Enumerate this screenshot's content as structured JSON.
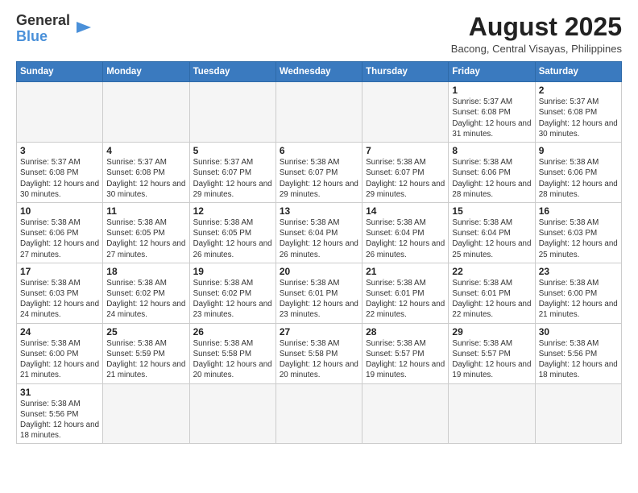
{
  "header": {
    "logo_general": "General",
    "logo_blue": "Blue",
    "month_year": "August 2025",
    "location": "Bacong, Central Visayas, Philippines"
  },
  "weekdays": [
    "Sunday",
    "Monday",
    "Tuesday",
    "Wednesday",
    "Thursday",
    "Friday",
    "Saturday"
  ],
  "weeks": [
    [
      {
        "day": "",
        "info": ""
      },
      {
        "day": "",
        "info": ""
      },
      {
        "day": "",
        "info": ""
      },
      {
        "day": "",
        "info": ""
      },
      {
        "day": "",
        "info": ""
      },
      {
        "day": "1",
        "info": "Sunrise: 5:37 AM\nSunset: 6:08 PM\nDaylight: 12 hours\nand 31 minutes."
      },
      {
        "day": "2",
        "info": "Sunrise: 5:37 AM\nSunset: 6:08 PM\nDaylight: 12 hours\nand 30 minutes."
      }
    ],
    [
      {
        "day": "3",
        "info": "Sunrise: 5:37 AM\nSunset: 6:08 PM\nDaylight: 12 hours\nand 30 minutes."
      },
      {
        "day": "4",
        "info": "Sunrise: 5:37 AM\nSunset: 6:08 PM\nDaylight: 12 hours\nand 30 minutes."
      },
      {
        "day": "5",
        "info": "Sunrise: 5:37 AM\nSunset: 6:07 PM\nDaylight: 12 hours\nand 29 minutes."
      },
      {
        "day": "6",
        "info": "Sunrise: 5:38 AM\nSunset: 6:07 PM\nDaylight: 12 hours\nand 29 minutes."
      },
      {
        "day": "7",
        "info": "Sunrise: 5:38 AM\nSunset: 6:07 PM\nDaylight: 12 hours\nand 29 minutes."
      },
      {
        "day": "8",
        "info": "Sunrise: 5:38 AM\nSunset: 6:06 PM\nDaylight: 12 hours\nand 28 minutes."
      },
      {
        "day": "9",
        "info": "Sunrise: 5:38 AM\nSunset: 6:06 PM\nDaylight: 12 hours\nand 28 minutes."
      }
    ],
    [
      {
        "day": "10",
        "info": "Sunrise: 5:38 AM\nSunset: 6:06 PM\nDaylight: 12 hours\nand 27 minutes."
      },
      {
        "day": "11",
        "info": "Sunrise: 5:38 AM\nSunset: 6:05 PM\nDaylight: 12 hours\nand 27 minutes."
      },
      {
        "day": "12",
        "info": "Sunrise: 5:38 AM\nSunset: 6:05 PM\nDaylight: 12 hours\nand 26 minutes."
      },
      {
        "day": "13",
        "info": "Sunrise: 5:38 AM\nSunset: 6:04 PM\nDaylight: 12 hours\nand 26 minutes."
      },
      {
        "day": "14",
        "info": "Sunrise: 5:38 AM\nSunset: 6:04 PM\nDaylight: 12 hours\nand 26 minutes."
      },
      {
        "day": "15",
        "info": "Sunrise: 5:38 AM\nSunset: 6:04 PM\nDaylight: 12 hours\nand 25 minutes."
      },
      {
        "day": "16",
        "info": "Sunrise: 5:38 AM\nSunset: 6:03 PM\nDaylight: 12 hours\nand 25 minutes."
      }
    ],
    [
      {
        "day": "17",
        "info": "Sunrise: 5:38 AM\nSunset: 6:03 PM\nDaylight: 12 hours\nand 24 minutes."
      },
      {
        "day": "18",
        "info": "Sunrise: 5:38 AM\nSunset: 6:02 PM\nDaylight: 12 hours\nand 24 minutes."
      },
      {
        "day": "19",
        "info": "Sunrise: 5:38 AM\nSunset: 6:02 PM\nDaylight: 12 hours\nand 23 minutes."
      },
      {
        "day": "20",
        "info": "Sunrise: 5:38 AM\nSunset: 6:01 PM\nDaylight: 12 hours\nand 23 minutes."
      },
      {
        "day": "21",
        "info": "Sunrise: 5:38 AM\nSunset: 6:01 PM\nDaylight: 12 hours\nand 22 minutes."
      },
      {
        "day": "22",
        "info": "Sunrise: 5:38 AM\nSunset: 6:01 PM\nDaylight: 12 hours\nand 22 minutes."
      },
      {
        "day": "23",
        "info": "Sunrise: 5:38 AM\nSunset: 6:00 PM\nDaylight: 12 hours\nand 21 minutes."
      }
    ],
    [
      {
        "day": "24",
        "info": "Sunrise: 5:38 AM\nSunset: 6:00 PM\nDaylight: 12 hours\nand 21 minutes."
      },
      {
        "day": "25",
        "info": "Sunrise: 5:38 AM\nSunset: 5:59 PM\nDaylight: 12 hours\nand 21 minutes."
      },
      {
        "day": "26",
        "info": "Sunrise: 5:38 AM\nSunset: 5:58 PM\nDaylight: 12 hours\nand 20 minutes."
      },
      {
        "day": "27",
        "info": "Sunrise: 5:38 AM\nSunset: 5:58 PM\nDaylight: 12 hours\nand 20 minutes."
      },
      {
        "day": "28",
        "info": "Sunrise: 5:38 AM\nSunset: 5:57 PM\nDaylight: 12 hours\nand 19 minutes."
      },
      {
        "day": "29",
        "info": "Sunrise: 5:38 AM\nSunset: 5:57 PM\nDaylight: 12 hours\nand 19 minutes."
      },
      {
        "day": "30",
        "info": "Sunrise: 5:38 AM\nSunset: 5:56 PM\nDaylight: 12 hours\nand 18 minutes."
      }
    ],
    [
      {
        "day": "31",
        "info": "Sunrise: 5:38 AM\nSunset: 5:56 PM\nDaylight: 12 hours\nand 18 minutes."
      },
      {
        "day": "",
        "info": ""
      },
      {
        "day": "",
        "info": ""
      },
      {
        "day": "",
        "info": ""
      },
      {
        "day": "",
        "info": ""
      },
      {
        "day": "",
        "info": ""
      },
      {
        "day": "",
        "info": ""
      }
    ]
  ]
}
